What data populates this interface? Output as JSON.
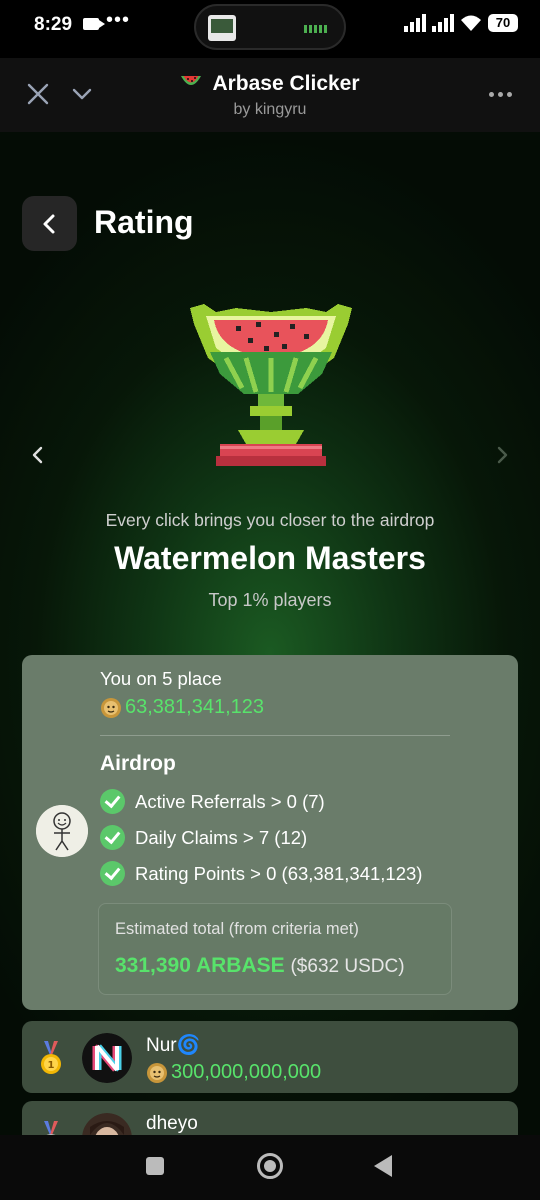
{
  "status_bar": {
    "time": "8:29",
    "battery": "70",
    "icons": [
      "video-camera-icon",
      "more-dots-icon",
      "signal-icon",
      "wifi-icon",
      "battery-icon"
    ]
  },
  "header": {
    "app_title": "Arbase Clicker",
    "subtitle": "by kingyru",
    "icons": [
      "close-icon",
      "chevron-down-icon",
      "watermelon-logo-icon",
      "more-options-icon"
    ]
  },
  "page": {
    "title": "Rating",
    "back_icon": "chevron-left-icon"
  },
  "league": {
    "tagline": "Every click brings you closer to the airdrop",
    "name": "Watermelon Masters",
    "subtitle": "Top 1% players",
    "trophy_icon": "watermelon-trophy-icon",
    "prev_icon": "chevron-left-icon",
    "next_icon": "chevron-right-icon"
  },
  "user_card": {
    "place_text": "You on 5 place",
    "coins": "63,381,341,123",
    "avatar_icon": "stick-figure-avatar",
    "airdrop_title": "Airdrop",
    "criteria": [
      {
        "label": "Active Referrals > 0 (7)",
        "met": true
      },
      {
        "label": "Daily Claims > 7 (12)",
        "met": true
      },
      {
        "label": "Rating Points > 0 (63,381,341,123)",
        "met": true
      }
    ],
    "estimate": {
      "label": "Estimated total (from criteria met)",
      "tokens": "331,390 ARBASE",
      "usd": "($632 USDC)"
    }
  },
  "leaderboard": [
    {
      "rank_icon": "gold-medal-icon",
      "name": "Nur🌀",
      "coins": "300,000,000,000"
    },
    {
      "rank_icon": "silver-medal-icon",
      "name": "dheyo",
      "coins": ""
    }
  ],
  "colors": {
    "accent_green": "#58e36b",
    "card_bg": "#6a7c6a",
    "row_bg": "#3e4e3e",
    "check_green": "#5bc86a"
  },
  "nav_bar": {
    "icons": [
      "recents-square-icon",
      "home-circle-icon",
      "back-triangle-icon"
    ]
  }
}
